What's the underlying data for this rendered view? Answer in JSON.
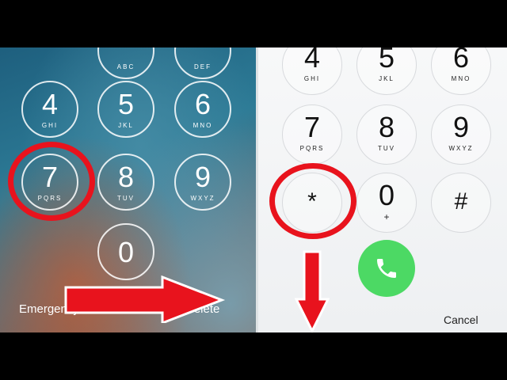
{
  "left_keypad": {
    "keys": [
      {
        "digit": "",
        "letters": "ABC"
      },
      {
        "digit": "",
        "letters": "DEF"
      },
      {
        "digit": "4",
        "letters": "GHI"
      },
      {
        "digit": "5",
        "letters": "JKL"
      },
      {
        "digit": "6",
        "letters": "MNO"
      },
      {
        "digit": "7",
        "letters": "PQRS"
      },
      {
        "digit": "8",
        "letters": "TUV"
      },
      {
        "digit": "9",
        "letters": "WXYZ"
      },
      {
        "digit": "0",
        "letters": ""
      }
    ],
    "emergency_label": "Emergency",
    "delete_label": "Delete"
  },
  "right_keypad": {
    "keys": [
      {
        "digit": "4",
        "letters": "GHI"
      },
      {
        "digit": "5",
        "letters": "JKL"
      },
      {
        "digit": "6",
        "letters": "MNO"
      },
      {
        "digit": "7",
        "letters": "PQRS"
      },
      {
        "digit": "8",
        "letters": "TUV"
      },
      {
        "digit": "9",
        "letters": "WXYZ"
      },
      {
        "digit": "*",
        "letters": ""
      },
      {
        "digit": "0",
        "letters": "+"
      },
      {
        "digit": "#",
        "letters": ""
      }
    ],
    "cancel_label": "Cancel"
  },
  "colors": {
    "highlight": "#e8131d",
    "call_button": "#4cd964"
  },
  "icons": [
    "phone-icon",
    "arrow-right-icon",
    "arrow-down-icon"
  ]
}
